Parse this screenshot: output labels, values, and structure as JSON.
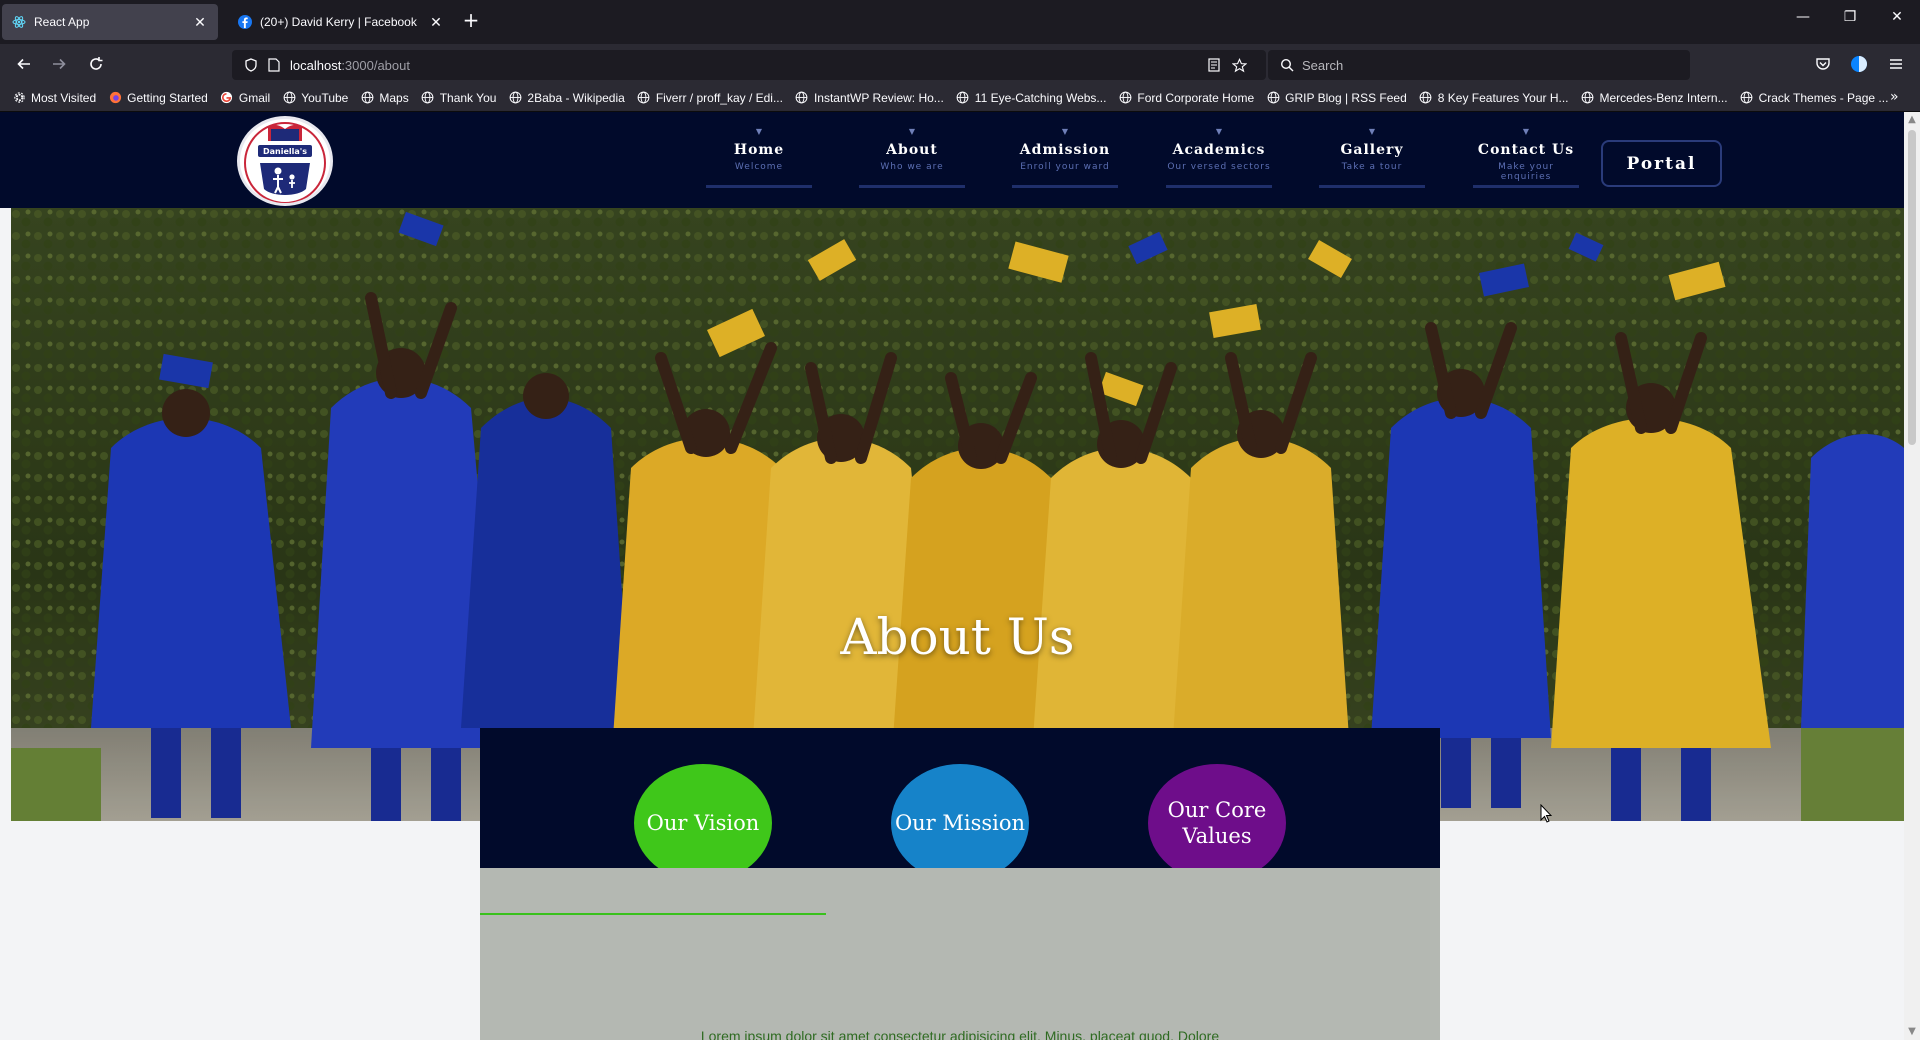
{
  "browser": {
    "tabs": [
      {
        "title": "React App",
        "icon": "react-icon",
        "active": true
      },
      {
        "title": "(20+) David Kerry | Facebook",
        "icon": "facebook-icon",
        "active": false
      }
    ],
    "url": {
      "host": "localhost",
      "path": ":3000/about"
    },
    "search_placeholder": "Search",
    "bookmarks": [
      "Most Visited",
      "Getting Started",
      "Gmail",
      "YouTube",
      "Maps",
      "Thank You",
      "2Baba - Wikipedia",
      "Fiverr / proff_kay / Edi...",
      "InstantWP Review: Ho...",
      "11 Eye-Catching Webs...",
      "Ford Corporate Home",
      "GRIP Blog | RSS Feed",
      "8 Key Features Your H...",
      "Mercedes-Benz Intern...",
      "Crack Themes - Page ..."
    ]
  },
  "site": {
    "menu": [
      {
        "label": "Home",
        "sub": "Welcome"
      },
      {
        "label": "About",
        "sub": "Who we are"
      },
      {
        "label": "Admission",
        "sub": "Enroll your ward"
      },
      {
        "label": "Academics",
        "sub": "Our versed sectors"
      },
      {
        "label": "Gallery",
        "sub": "Take a tour"
      },
      {
        "label": "Contact Us",
        "sub": "Make your enquiries"
      }
    ],
    "portal_label": "Portal",
    "logo_text": "Daniella's",
    "hero_title": "About Us",
    "tabs": [
      {
        "label": "Our Vision",
        "color": "#3fc71a"
      },
      {
        "label": "Our Mission",
        "color": "#1683c9"
      },
      {
        "label": "Our Core Values",
        "color": "#6e0d8a"
      }
    ],
    "content_text": "Lorem ipsum dolor sit amet consectetur adipisicing elit. Minus, placeat quod. Dolore"
  },
  "colors": {
    "header": "#010a2b",
    "accent_green": "#39c11c"
  }
}
